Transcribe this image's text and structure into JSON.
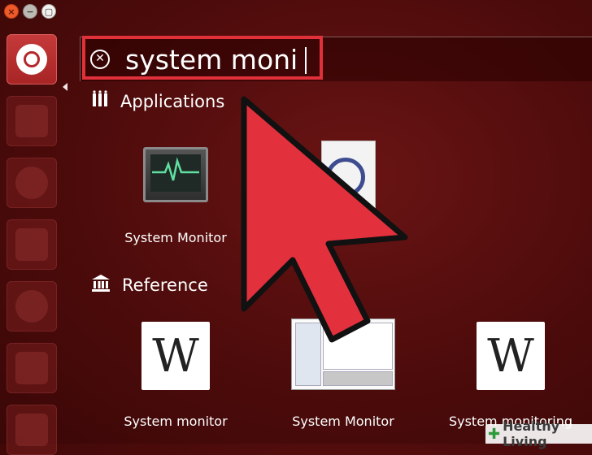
{
  "search": {
    "query": "system moni"
  },
  "sections": {
    "applications": "Applications",
    "reference": "Reference"
  },
  "apps": [
    {
      "label": "System Monitor",
      "icon": "system-monitor-icon"
    }
  ],
  "reference": [
    {
      "label": "System monitor",
      "icon": "wikipedia-icon"
    },
    {
      "label": "System Monitor",
      "icon": "screenshot-icon"
    },
    {
      "label": "System monitoring",
      "icon": "wikipedia-icon"
    }
  ],
  "wiki_glyph": "W",
  "watermark": {
    "text": "Healthy Living"
  },
  "colors": {
    "background": "#4d0b0b",
    "highlight": "#e0303a",
    "pointer": "#e2303c"
  }
}
